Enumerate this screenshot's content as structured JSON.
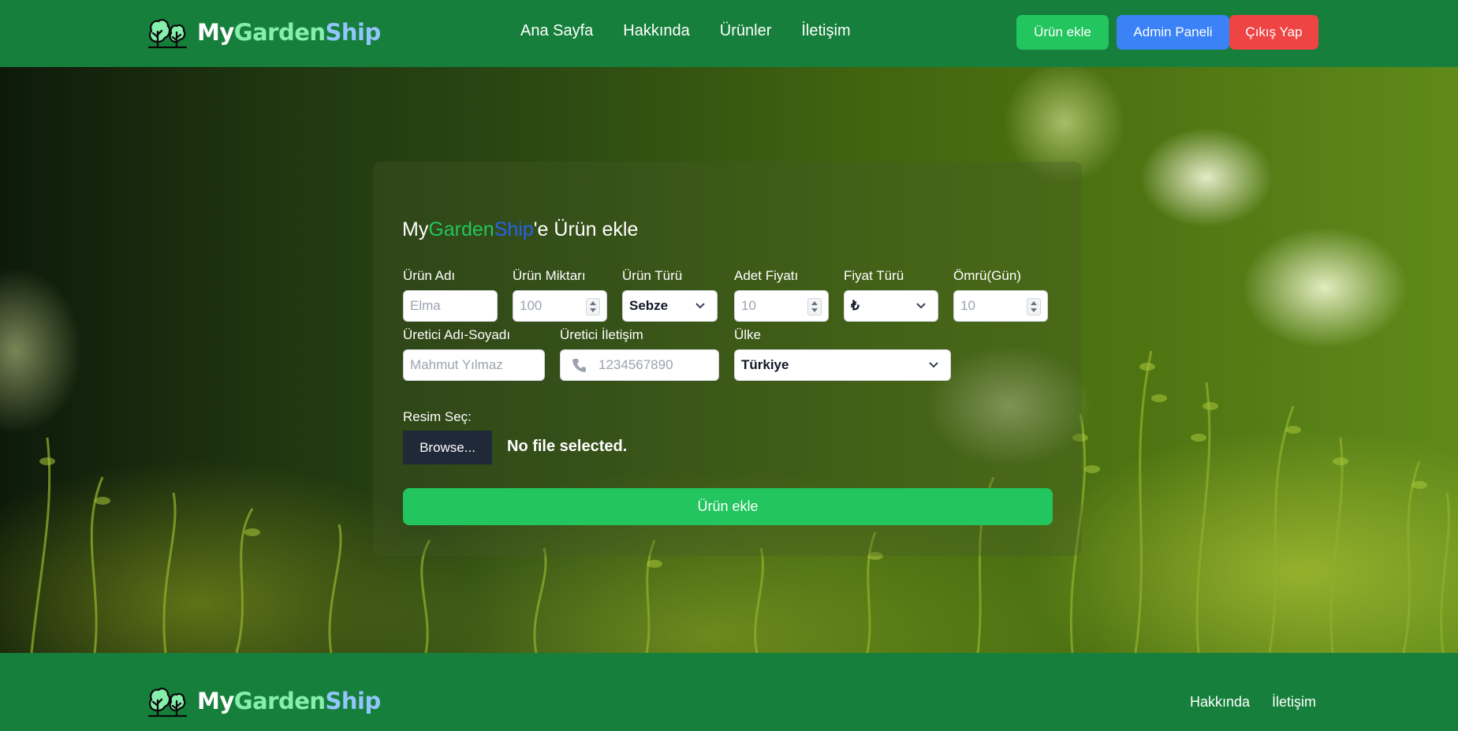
{
  "brand": {
    "my": "My",
    "garden": "Garden",
    "ship": "Ship"
  },
  "nav": {
    "links": [
      "Ana Sayfa",
      "Hakkında",
      "Ürünler",
      "İletişim"
    ],
    "actions": {
      "add": "Ürün ekle",
      "admin": "Admin Paneli",
      "logout": "Çıkış Yap"
    }
  },
  "form": {
    "title": {
      "my": "My",
      "garden": "Garden",
      "ship": "Ship",
      "suffix": "'e Ürün ekle"
    },
    "fields": {
      "name": {
        "label": "Ürün Adı",
        "placeholder": "Elma"
      },
      "quantity": {
        "label": "Ürün Miktarı",
        "placeholder": "100"
      },
      "type": {
        "label": "Ürün Türü",
        "value": "Sebze"
      },
      "unit_price": {
        "label": "Adet Fiyatı",
        "placeholder": "10"
      },
      "currency": {
        "label": "Fiyat Türü",
        "value": "₺"
      },
      "lifespan": {
        "label": "Ömrü(Gün)",
        "placeholder": "10"
      },
      "producer": {
        "label": "Üretici Adı-Soyadı",
        "placeholder": "Mahmut Yılmaz"
      },
      "contact": {
        "label": "Üretici İletişim",
        "placeholder": "1234567890"
      },
      "country": {
        "label": "Ülke",
        "value": "Türkiye"
      }
    },
    "image": {
      "label": "Resim Seç:",
      "browse": "Browse...",
      "status": "No file selected."
    },
    "submit": "Ürün ekle"
  },
  "footer": {
    "links": [
      "Hakkında",
      "İletişim"
    ]
  },
  "colors": {
    "nav_bg": "#157f3b",
    "green": "#22c55e",
    "blue": "#3b82f6",
    "red": "#ef4444",
    "dark": "#1f2937"
  },
  "icons": [
    "tree-logo-icon",
    "phone-icon",
    "chevron-down-icon",
    "spinner-icon"
  ]
}
